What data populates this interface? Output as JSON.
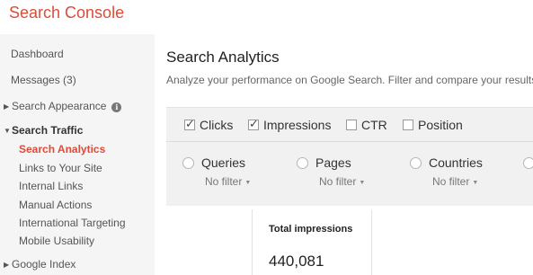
{
  "app": {
    "title": "Search Console"
  },
  "sidebar": {
    "dashboard": "Dashboard",
    "messages": "Messages (3)",
    "search_appearance": "Search Appearance",
    "search_traffic": "Search Traffic",
    "search_traffic_items": [
      "Search Analytics",
      "Links to Your Site",
      "Internal Links",
      "Manual Actions",
      "International Targeting",
      "Mobile Usability"
    ],
    "google_index": "Google Index"
  },
  "main": {
    "title": "Search Analytics",
    "subtitle": "Analyze your performance on Google Search. Filter and compare your results"
  },
  "metrics": [
    {
      "label": "Clicks",
      "checked": true
    },
    {
      "label": "Impressions",
      "checked": true
    },
    {
      "label": "CTR",
      "checked": false
    },
    {
      "label": "Position",
      "checked": false
    }
  ],
  "groups": [
    {
      "label": "Queries",
      "filter": "No filter"
    },
    {
      "label": "Pages",
      "filter": "No filter"
    },
    {
      "label": "Countries",
      "filter": "No filter"
    }
  ],
  "stats": {
    "total_impressions_label": "Total impressions",
    "total_impressions_value": "440,081"
  },
  "colors": {
    "accent": "#dd4b39",
    "sidebar_bg": "#f5f5f5",
    "panel_bg": "#f1f1f1"
  },
  "icons": {
    "info": "info-icon",
    "caret_right": "caret-right-icon",
    "caret_down": "caret-down-icon"
  }
}
